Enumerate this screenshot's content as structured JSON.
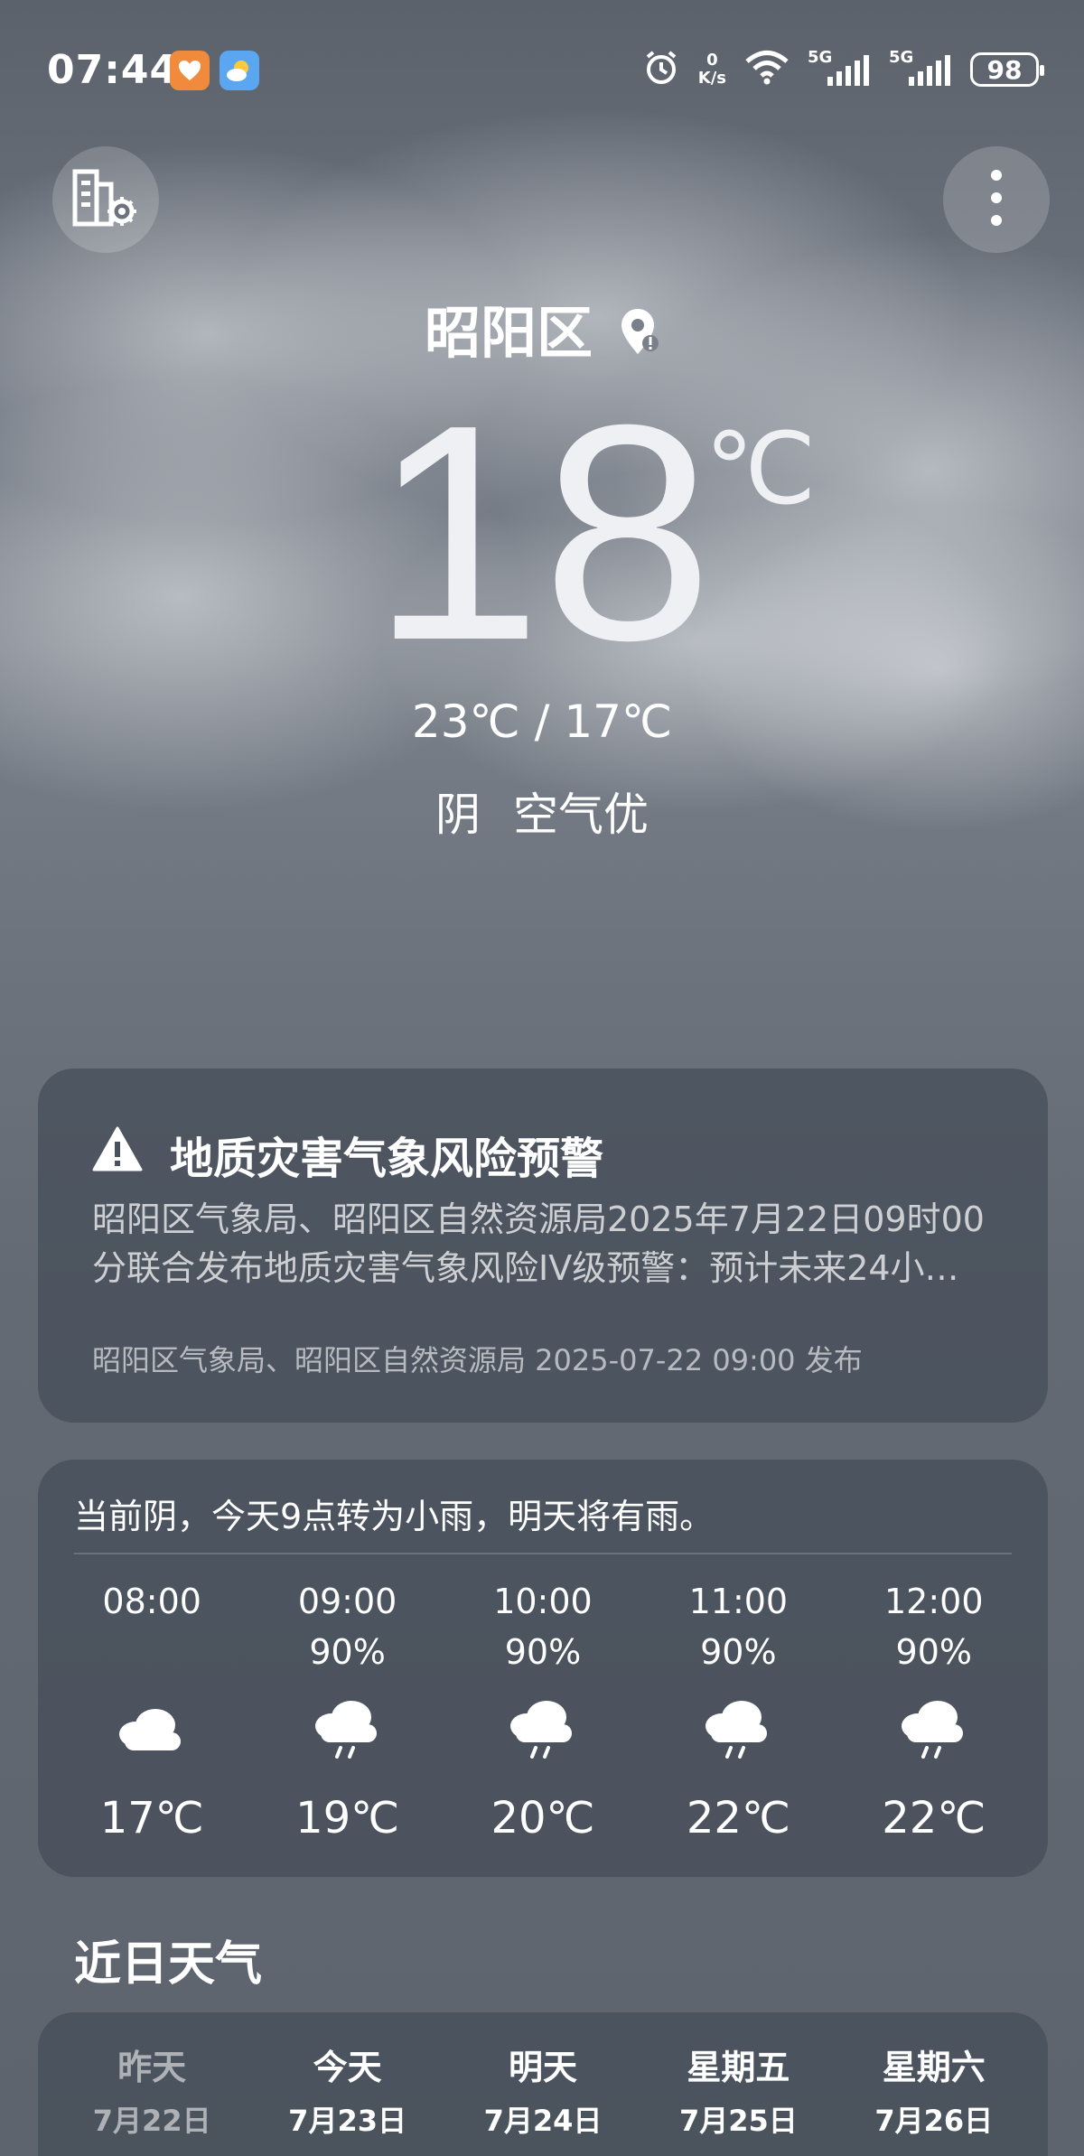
{
  "status_bar": {
    "time": "07:44",
    "net_speed_value": "0",
    "net_speed_unit": "K/s",
    "sim1": "5G",
    "sim2": "5G",
    "battery": "98",
    "icons": [
      "health-app-icon",
      "weather-app-icon",
      "alarm-icon",
      "wifi-icon",
      "signal-icon",
      "battery-icon"
    ]
  },
  "header": {
    "location": "昭阳区",
    "current_temp": "18",
    "temp_unit": "℃",
    "high_low": "23℃ / 17℃",
    "condition": "阴 空气优"
  },
  "alert": {
    "title": "地质灾害气象风险预警",
    "body_line1": "昭阳区气象局、昭阳区自然资源局2025年7月22日09时00",
    "body_line2": "分联合发布地质灾害气象风险IV级预警：预计未来24小…",
    "footer": "昭阳区气象局、昭阳区自然资源局 2025-07-22 09:00 发布"
  },
  "hourly": {
    "summary": "当前阴，今天9点转为小雨，明天将有雨。",
    "hours": [
      {
        "time": "08:00",
        "precip": "",
        "icon": "cloudy-icon",
        "temp": "17℃"
      },
      {
        "time": "09:00",
        "precip": "90%",
        "icon": "light-rain-icon",
        "temp": "19℃"
      },
      {
        "time": "10:00",
        "precip": "90%",
        "icon": "light-rain-icon",
        "temp": "20℃"
      },
      {
        "time": "11:00",
        "precip": "90%",
        "icon": "light-rain-icon",
        "temp": "22℃"
      },
      {
        "time": "12:00",
        "precip": "90%",
        "icon": "light-rain-icon",
        "temp": "22℃"
      }
    ]
  },
  "daily": {
    "title": "近日天气",
    "days": [
      {
        "name": "昨天",
        "date": "7月22日"
      },
      {
        "name": "今天",
        "date": "7月23日"
      },
      {
        "name": "明天",
        "date": "7月24日"
      },
      {
        "name": "星期五",
        "date": "7月25日"
      },
      {
        "name": "星期六",
        "date": "7月26日"
      }
    ]
  }
}
